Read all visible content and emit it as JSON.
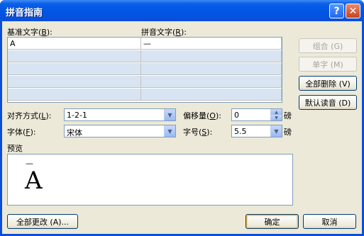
{
  "window": {
    "title": "拼音指南",
    "help_glyph": "?",
    "close_glyph": "✕"
  },
  "labels": {
    "base_text": "基准文字",
    "base_text_key": "B",
    "ruby_text": "拼音文字",
    "ruby_text_key": "R",
    "alignment": "对齐方式",
    "alignment_key": "L",
    "offset": "偏移量",
    "offset_key": "O",
    "font": "字体",
    "font_key": "F",
    "size": "字号",
    "size_key": "S",
    "unit_offset": "磅",
    "unit_size": "磅",
    "preview": "预览"
  },
  "grid": {
    "rows": [
      {
        "base": "A",
        "ruby": "—"
      },
      {
        "base": "",
        "ruby": ""
      },
      {
        "base": "",
        "ruby": ""
      },
      {
        "base": "",
        "ruby": ""
      },
      {
        "base": "",
        "ruby": ""
      }
    ]
  },
  "fields": {
    "alignment": "1-2-1",
    "offset": "0",
    "font": "宋体",
    "size": "5.5"
  },
  "buttons": {
    "combine": "组合 (G)",
    "single": "单字 (M)",
    "clear_all": "全部删除 (V)",
    "default_reading": "默认读音 (D)",
    "change_all": "全部更改 (A)...",
    "ok": "确定",
    "cancel": "取消"
  },
  "preview": {
    "ruby": "—",
    "base": "A"
  }
}
